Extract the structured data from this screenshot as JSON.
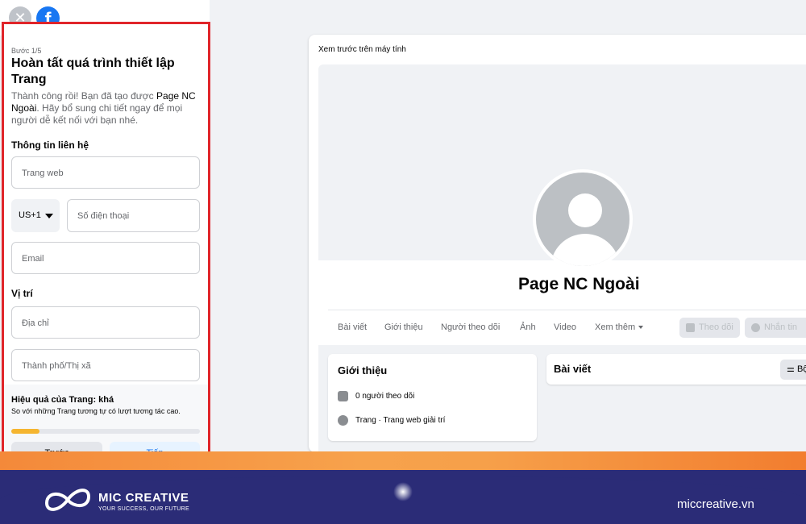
{
  "left_panel": {
    "step": "Bước 1/5",
    "title": "Hoàn tất quá trình thiết lập Trang",
    "desc_prefix": "Thành công rồi! Bạn đã tạo được ",
    "page_name": "Page NC Ngoài",
    "desc_suffix": ". Hãy bổ sung chi tiết ngay để mọi người dễ kết nối với bạn nhé.",
    "contact_section": "Thông tin liên hệ",
    "website_placeholder": "Trang web",
    "country_code": "US+1",
    "phone_placeholder": "Số điện thoại",
    "email_placeholder": "Email",
    "location_section": "Vị trí",
    "address_placeholder": "Địa chỉ",
    "city_placeholder": "Thành phố/Thị xã",
    "effect_title": "Hiệu quả của Trang: khá",
    "effect_desc": "So với những Trang tương tự có lượt tương tác cao.",
    "effect_progress": 0.15,
    "prev_button": "Trước",
    "next_button": "Tiếp"
  },
  "preview": {
    "label": "Xem trước trên máy tính",
    "page_name": "Page NC Ngoài",
    "tabs": [
      "Bài viết",
      "Giới thiệu",
      "Người theo dõi",
      "Ảnh",
      "Video",
      "Xem thêm"
    ],
    "follow_button": "Theo dõi",
    "message_button": "Nhắn tin",
    "intro_title": "Giới thiệu",
    "followers": "0 người theo dõi",
    "category": "Trang · Trang web giải trí",
    "posts_title": "Bài viết",
    "filter_label": "Bộ"
  },
  "footer": {
    "brand": "MIC CREATIVE",
    "tagline": "YOUR SUCCESS, OUR FUTURE",
    "website": "miccreative.vn"
  },
  "colors": {
    "accent": "#1877f2",
    "highlight_border": "#e0252a",
    "footer_bg": "#2b2c77",
    "footer_orange": "#f4893a"
  }
}
